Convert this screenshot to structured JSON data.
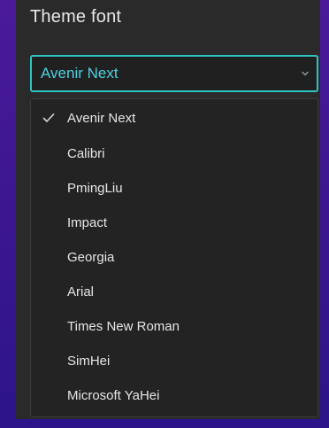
{
  "theme_font": {
    "label": "Theme font",
    "selected": "Avenir Next",
    "options": [
      "Avenir Next",
      "Calibri",
      "PmingLiu",
      "Impact",
      "Georgia",
      "Arial",
      "Times New Roman",
      "SimHei",
      "Microsoft YaHei"
    ],
    "icons": {
      "dropdown": "chevron-down-icon",
      "selected_marker": "check-icon"
    }
  },
  "colors": {
    "accent": "#2ec4c4",
    "selected_text": "#4fd0e0",
    "panel_bg": "#2a2a2a",
    "menu_bg": "#232323",
    "page_bg": "#4a1c9c"
  }
}
